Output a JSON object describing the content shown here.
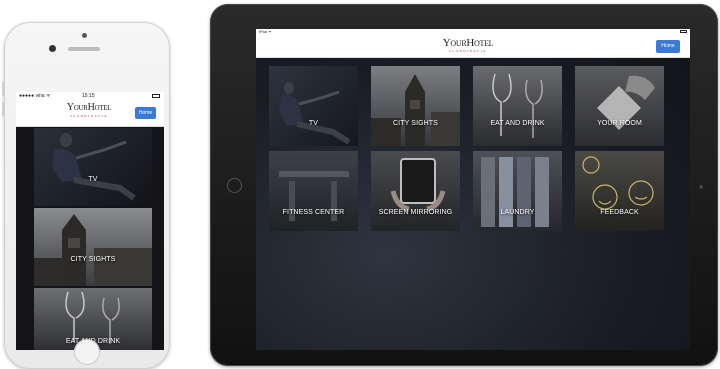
{
  "phone": {
    "status": {
      "carrier": "●●●●● vina ᯤ",
      "time": "15:15"
    },
    "logo": {
      "title": "YourHotel",
      "subtitle": "SCANDINAVIA"
    },
    "home_button": "Home",
    "tiles": [
      {
        "label": "TV"
      },
      {
        "label": "CITY SIGHTS"
      },
      {
        "label": "EAT AND DRINK"
      }
    ]
  },
  "tablet": {
    "status": {
      "device": "iPad ᯤ"
    },
    "logo": {
      "title": "YourHotel",
      "subtitle": "SCANDINAVIA"
    },
    "home_button": "Home",
    "tiles": [
      {
        "label": "TV"
      },
      {
        "label": "CITY SIGHTS"
      },
      {
        "label": "EAT AND DRINK"
      },
      {
        "label": "YOUR ROOM"
      },
      {
        "label": "FITNESS CENTER"
      },
      {
        "label": "SCREEN MIRRORING"
      },
      {
        "label": "LAUNDRY"
      },
      {
        "label": "FEEDBACK"
      }
    ]
  },
  "colors": {
    "accent": "#3a7bd5",
    "brand_red": "#b0161e"
  }
}
